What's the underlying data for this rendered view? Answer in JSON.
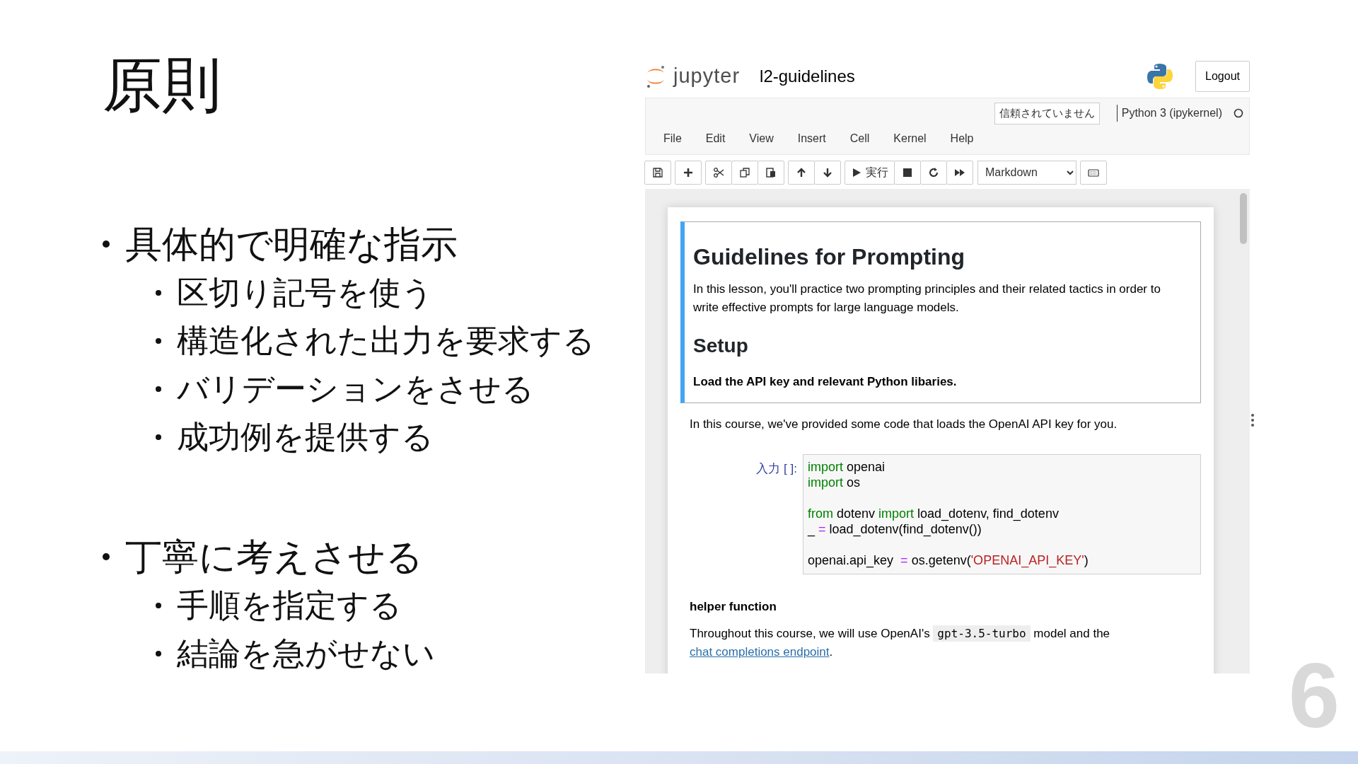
{
  "slide": {
    "title": "原則",
    "bullets": [
      {
        "text": "具体的で明確な指示",
        "children": [
          {
            "text": "区切り記号を使う"
          },
          {
            "text": "構造化された出力を要求する"
          },
          {
            "text": "バリデーションをさせる"
          },
          {
            "text": "成功例を提供する"
          }
        ]
      },
      {
        "text": "丁寧に考えさせる",
        "children": [
          {
            "text": "手順を指定する"
          },
          {
            "text": "結論を急がせない"
          }
        ]
      }
    ],
    "page_number": "6"
  },
  "notebook": {
    "logo_text": "jupyter",
    "title": "l2-guidelines",
    "logout": "Logout",
    "trust": "信頼されていません",
    "kernel": "Python 3 (ipykernel)",
    "menu": [
      "File",
      "Edit",
      "View",
      "Insert",
      "Cell",
      "Kernel",
      "Help"
    ],
    "toolbar": {
      "run_label": "実行",
      "cell_type": "Markdown"
    },
    "cells": [
      {
        "kind": "markdown",
        "selected": true,
        "blocks": [
          {
            "kind": "h1",
            "text": "Guidelines for Prompting"
          },
          {
            "kind": "p",
            "text": "In this lesson, you'll practice two prompting principles and their related tactics in order to write effective prompts for large language models."
          },
          {
            "kind": "h2",
            "text": "Setup"
          },
          {
            "kind": "bold",
            "text": "Load the API key and relevant Python libaries."
          }
        ]
      },
      {
        "kind": "markdown",
        "selected": false,
        "blocks": [
          {
            "kind": "p",
            "text": "In this course, we've provided some code that loads the OpenAI API key for you."
          }
        ]
      },
      {
        "kind": "code",
        "selected": false,
        "prompt": "入力 [ ]:",
        "blocks": [
          [
            [
              {
                "kind": "kw",
                "text": "import"
              },
              {
                "kind": "name",
                "text": " openai"
              }
            ],
            [
              {
                "kind": "kw",
                "text": "import"
              },
              {
                "kind": "name",
                "text": " os"
              }
            ]
          ],
          [
            [
              {
                "kind": "kw",
                "text": "from"
              },
              {
                "kind": "name",
                "text": " dotenv "
              },
              {
                "kind": "kw",
                "text": "import"
              },
              {
                "kind": "name",
                "text": " load_dotenv, find_dotenv"
              }
            ],
            [
              {
                "kind": "name",
                "text": "_ "
              },
              {
                "kind": "op",
                "text": "="
              },
              {
                "kind": "name",
                "text": " load_dotenv(find_dotenv())"
              }
            ]
          ],
          [
            [
              {
                "kind": "name",
                "text": "openai.api_key  "
              },
              {
                "kind": "op",
                "text": "="
              },
              {
                "kind": "name",
                "text": " os.getenv("
              },
              {
                "kind": "str",
                "text": "'OPENAI_API_KEY'"
              },
              {
                "kind": "name",
                "text": ")"
              }
            ]
          ]
        ]
      },
      {
        "kind": "markdown",
        "selected": false,
        "blocks": [
          {
            "kind": "bold",
            "text": "helper function"
          },
          {
            "kind": "segments",
            "parts": [
              {
                "kind": "text",
                "text": "Throughout this course, we will use OpenAI's "
              },
              {
                "kind": "code",
                "text": "gpt-3.5-turbo"
              },
              {
                "kind": "text",
                "text": " model and the "
              },
              {
                "kind": "link",
                "text": "chat completions endpoint"
              },
              {
                "kind": "text",
                "text": "."
              }
            ]
          }
        ]
      }
    ]
  }
}
